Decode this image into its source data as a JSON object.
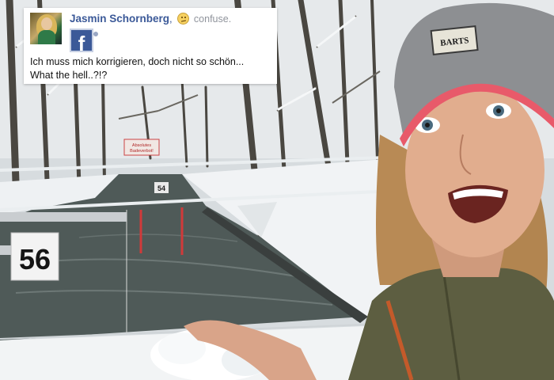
{
  "post": {
    "user_name": "Jasmin Schornberg",
    "separator": ",",
    "emoji_icon": "confused-face-icon",
    "feeling": "confuse.",
    "text_line1": "Ich muss mich korrigieren, doch nicht so schön...",
    "text_line2": "What the hell..?!?",
    "network_icon": "facebook-icon",
    "network_glyph": "f"
  },
  "scene": {
    "gauge_sign_large": "56",
    "gauge_sign_small": "54",
    "hat_label": "BARTS",
    "warning_sign": "Absolutes Badeverbot!"
  },
  "colors": {
    "facebook_blue": "#3b5998",
    "hat_gray": "#8d8f92",
    "hat_trim": "#e85a6a",
    "jacket_olive": "#5d5e41",
    "water": "#4f5a58",
    "snow": "#f2f4f5"
  }
}
